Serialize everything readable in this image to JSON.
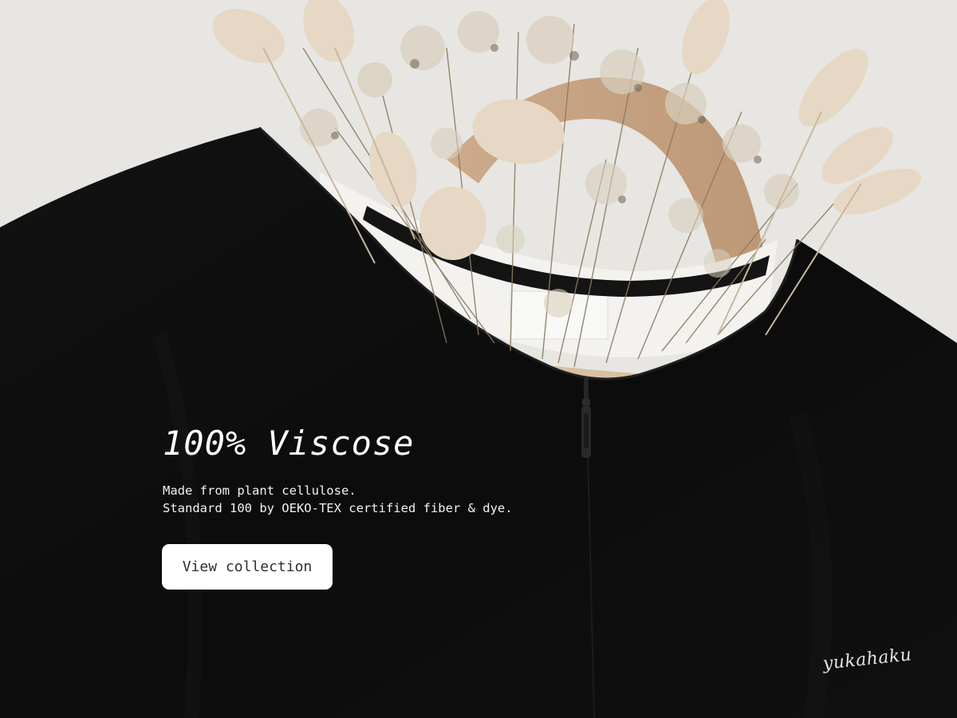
{
  "hero": {
    "headline": "100% Viscose",
    "description_lines": [
      "Made from plant cellulose.",
      "Standard 100 by OEKO-TEX certified fiber & dye."
    ],
    "cta_label": "View collection",
    "signature": "yukahaku"
  },
  "colors": {
    "wall": "#e9e8e4",
    "garment": "#0d0d0d",
    "text": "#ffffff",
    "button_bg": "#ffffff",
    "button_text": "#2f2f2f",
    "dried_flowers": "#cbbfa6"
  },
  "icons": [
    "zipper-pull-icon"
  ]
}
